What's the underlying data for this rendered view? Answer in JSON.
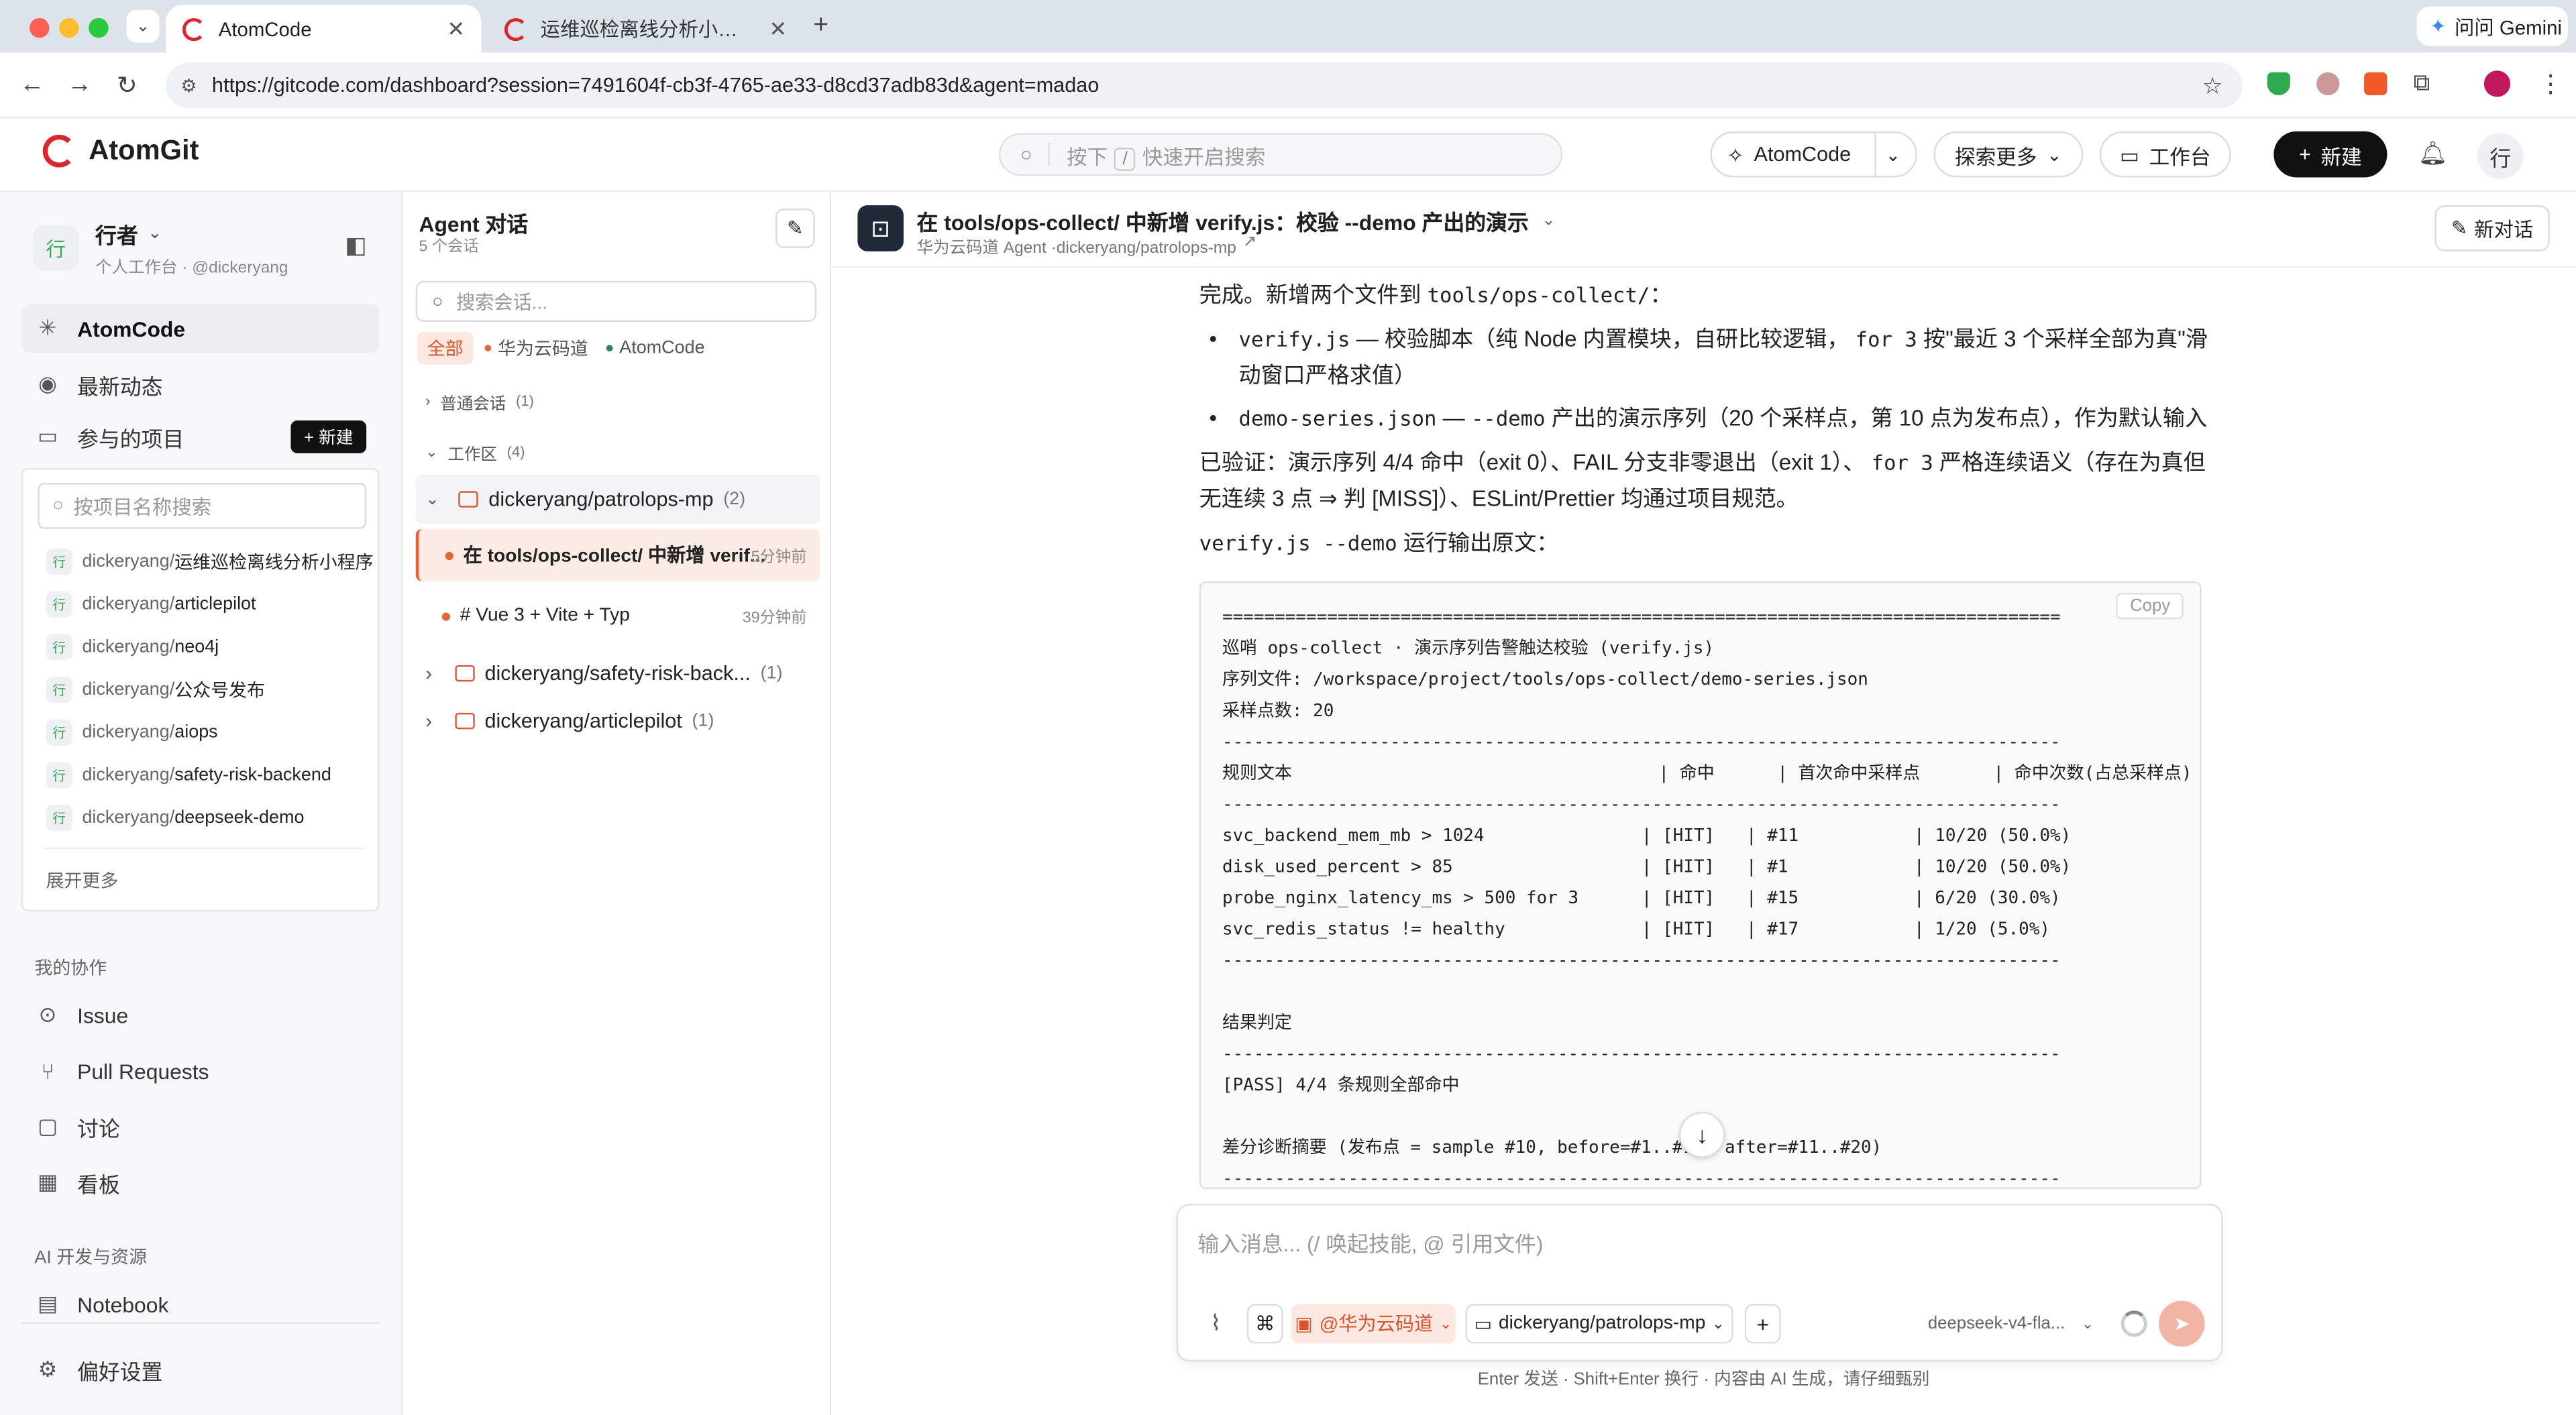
{
  "browser": {
    "tabs": [
      {
        "title": "AtomCode",
        "active": true
      },
      {
        "title": "运维巡检离线分析小程序:把运维",
        "active": false
      }
    ],
    "url": "https://gitcode.com/dashboard?session=7491604f-cb3f-4765-ae33-d8cd37adb83d&agent=madao",
    "gemini_label": "问问 Gemini",
    "colors": {
      "close": "#ff5f57",
      "minimize": "#febc2e",
      "maximize": "#28c840"
    }
  },
  "header": {
    "brand": "AtomGit",
    "search_placeholder": "按下",
    "search_key": "/",
    "search_hint": "快速开启搜索",
    "atomcode_label": "AtomCode",
    "explore_label": "探索更多",
    "workbench_label": "工作台",
    "new_label": "新建",
    "avatar_text": "行"
  },
  "sidebar": {
    "user_name": "行者",
    "user_sub": "个人工作台 · @dickeryang",
    "avatar_text": "行",
    "nav": [
      {
        "label": "AtomCode",
        "icon": "sparkle-icon",
        "active": true
      },
      {
        "label": "最新动态",
        "icon": "broadcast-icon"
      },
      {
        "label": "参与的项目",
        "icon": "folder-icon"
      }
    ],
    "new_button": "+ 新建",
    "project_search_placeholder": "按项目名称搜索",
    "projects": [
      {
        "owner": "dickeryang/",
        "name": "运维巡检离线分析小程序"
      },
      {
        "owner": "dickeryang/",
        "name": "articlepilot"
      },
      {
        "owner": "dickeryang/",
        "name": "neo4j"
      },
      {
        "owner": "dickeryang/",
        "name": "公众号发布"
      },
      {
        "owner": "dickeryang/",
        "name": "aiops"
      },
      {
        "owner": "dickeryang/",
        "name": "safety-risk-backend"
      },
      {
        "owner": "dickeryang/",
        "name": "deepseek-demo"
      }
    ],
    "expand_more": "展开更多",
    "collab_title": "我的协作",
    "collab": [
      "Issue",
      "Pull Requests",
      "讨论",
      "看板"
    ],
    "ai_title": "AI 开发与资源",
    "notebook": "Notebook",
    "prefs": "偏好设置"
  },
  "conversations": {
    "title": "Agent 对话",
    "count": "5 个会话",
    "search_placeholder": "搜索会话...",
    "filters": [
      "全部",
      "华为云码道",
      "AtomCode"
    ],
    "normal_group": "普通会话",
    "normal_count": "(1)",
    "workspace_group": "工作区",
    "workspace_count": "(4)",
    "repos": [
      {
        "name": "dickeryang/patrolops-mp",
        "count": "(2)"
      },
      {
        "name": "dickeryang/safety-risk-back...",
        "count": "(1)"
      },
      {
        "name": "dickeryang/articlepilot",
        "count": "(1)"
      }
    ],
    "sessions": [
      {
        "title": "在 tools/ops-collect/ 中新增 verif...",
        "time": "5分钟前"
      },
      {
        "title": "# Vue 3 + Vite + Typ",
        "time": "39分钟前"
      }
    ]
  },
  "chat": {
    "title": "在 tools/ops-collect/ 中新增 verify.js：校验 --demo 产出的演示",
    "subtitle": "华为云码道 Agent ·dickeryang/patrolops-mp",
    "new_chat": "新对话",
    "intro_a": "完成。新增两个文件到",
    "intro_path": "tools/ops-collect/",
    "intro_b": "：",
    "bullet1_code": "verify.js",
    "bullet1_a": "— 校验脚本（纯 Node 内置模块，自研比较逻辑，",
    "bullet1_code2": "for 3",
    "bullet1_b": "按\"最近 3 个采样全部为真\"滑动窗口严格求值）",
    "bullet2_code": "demo-series.json",
    "bullet2_a": "—",
    "bullet2_code2": "--demo",
    "bullet2_b": "产出的演示序列（20 个采样点，第 10 点为发布点），作为默认输入",
    "verify_a": "已验证：演示序列 4/4 命中（exit 0）、FAIL 分支非零退出（exit 1）、",
    "verify_code": "for 3",
    "verify_b": "严格连续语义（存在为真但无连续 3 点 ⇒ 判 [MISS]）、ESLint/Prettier 均通过项目规范。",
    "output_code": "verify.js --demo",
    "output_label": "运行输出原文：",
    "copy_label": "Copy",
    "code_lines": [
      "================================================================================",
      "巡哨 ops-collect · 演示序列告警触达校验 (verify.js)",
      "序列文件: /workspace/project/tools/ops-collect/demo-series.json",
      "采样点数: 20",
      "--------------------------------------------------------------------------------",
      "规则文本                                   | 命中      | 首次命中采样点       | 命中次数(占总采样点)",
      "--------------------------------------------------------------------------------",
      "svc_backend_mem_mb > 1024               | [HIT]   | #11           | 10/20 (50.0%)",
      "disk_used_percent > 85                  | [HIT]   | #1            | 10/20 (50.0%)",
      "probe_nginx_latency_ms > 500 for 3      | [HIT]   | #15           | 6/20 (30.0%)",
      "svc_redis_status != healthy             | [HIT]   | #17           | 1/20 (5.0%)",
      "--------------------------------------------------------------------------------",
      "",
      "结果判定",
      "--------------------------------------------------------------------------------",
      "[PASS] 4/4 条规则全部命中",
      "",
      "差分诊断摘要 (发布点 = sample #10, before=#1..#10, after=#11..#20)",
      "--------------------------------------------------------------------------------"
    ],
    "composer_placeholder": "输入消息...  (/ 唤起技能, @ 引用文件)",
    "agent_chip": "@华为云码道",
    "repo_chip": "dickeryang/patrolops-mp",
    "model": "deepseek-v4-fla...",
    "footer": "Enter 发送 · Shift+Enter 换行 · 内容由 AI 生成，请仔细甄别",
    "accent": "#e0663c"
  }
}
